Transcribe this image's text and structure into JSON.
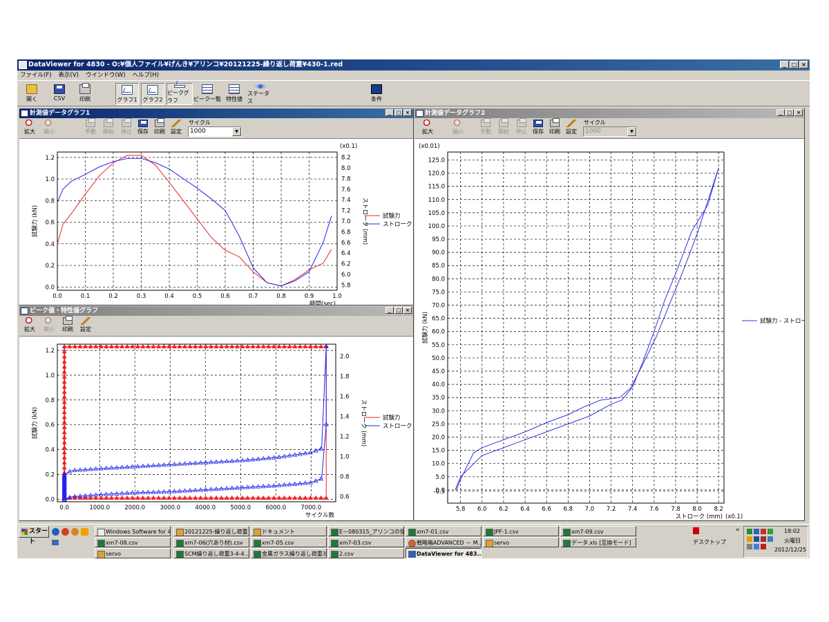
{
  "app": {
    "title": "DataViewer for 4830 - O:¥個人ファイル¥げんき¥アリンコ¥20121225-繰り返し荷重¥430-1.red"
  },
  "menu": [
    "ファイル(F)",
    "表示(V)",
    "ウインドウ(W)",
    "ヘルプ(H)"
  ],
  "toolbar": {
    "open": "開く",
    "csv": "CSV",
    "print": "印刷",
    "graph1": "グラフ1",
    "graph2": "グラフ2",
    "peak_graph": "ピークグラフ",
    "peak_list": "ピーク一覧",
    "characteristic": "特性値",
    "status": "ステータス",
    "condition": "条件"
  },
  "win_buttons": {
    "min": "_",
    "max": "□",
    "close": "×"
  },
  "graph1": {
    "title": "計測値データグラフ1",
    "tools": {
      "zoom_in": "拡大",
      "zoom_out": "縮小",
      "manual": "手動",
      "start": "開始",
      "stop": "停止",
      "save": "保存",
      "print": "印刷",
      "settings": "設定"
    },
    "cycle_label": "サイクル",
    "cycle_value": "1000",
    "combo_arrow": "▼"
  },
  "graph2": {
    "title": "計測値データグラフ2",
    "tools": {
      "zoom_in": "拡大",
      "zoom_out": "縮小",
      "manual": "手動",
      "start": "開始",
      "stop": "停止",
      "save": "保存",
      "print": "印刷",
      "settings": "設定"
    },
    "cycle_label": "サイクル",
    "cycle_value": "1000",
    "combo_arrow": "▼"
  },
  "peak": {
    "title": "ピーク値・特性値グラフ",
    "tools": {
      "zoom_in": "拡大",
      "zoom_out": "縮小",
      "print": "印刷",
      "settings": "設定"
    }
  },
  "chart_data": [
    {
      "id": "g1",
      "type": "line",
      "xlabel": "時間(sec)",
      "ylabel": "試験力 (kN)",
      "y2label": "ストローク (mm)",
      "y2unit": "(x0.1)",
      "xlim": [
        0,
        1.0
      ],
      "ylim": [
        -0.03,
        1.25
      ],
      "y2lim": [
        5.7,
        8.3
      ],
      "xticks": [
        "0.0",
        "0.1",
        "0.2",
        "0.3",
        "0.4",
        "0.5",
        "0.6",
        "0.7",
        "0.8",
        "0.9",
        "1.0"
      ],
      "yticks": [
        "0.0",
        "0.2",
        "0.4",
        "0.6",
        "0.8",
        "1.0",
        "1.2"
      ],
      "y2ticks": [
        "5.8",
        "6.0",
        "6.2",
        "6.4",
        "6.6",
        "6.8",
        "7.0",
        "7.2",
        "7.4",
        "7.6",
        "7.8",
        "8.0",
        "8.2"
      ],
      "legend_position": "right",
      "series": [
        {
          "name": "試験力",
          "color": "#ee2222",
          "axis": "y",
          "x": [
            0,
            0.02,
            0.05,
            0.1,
            0.15,
            0.2,
            0.25,
            0.3,
            0.35,
            0.4,
            0.45,
            0.5,
            0.55,
            0.6,
            0.65,
            0.7,
            0.75,
            0.8,
            0.85,
            0.9,
            0.95,
            0.98
          ],
          "y": [
            0.4,
            0.58,
            0.68,
            0.86,
            1.03,
            1.15,
            1.22,
            1.22,
            1.13,
            0.97,
            0.8,
            0.63,
            0.46,
            0.34,
            0.28,
            0.14,
            0.04,
            0.01,
            0.07,
            0.16,
            0.22,
            0.35
          ]
        },
        {
          "name": "ストローク",
          "color": "#2222ee",
          "axis": "y2",
          "x": [
            0,
            0.02,
            0.05,
            0.1,
            0.15,
            0.2,
            0.25,
            0.3,
            0.35,
            0.4,
            0.45,
            0.5,
            0.55,
            0.6,
            0.65,
            0.7,
            0.75,
            0.8,
            0.85,
            0.9,
            0.95,
            0.98
          ],
          "y": [
            7.35,
            7.6,
            7.75,
            7.88,
            8.02,
            8.12,
            8.18,
            8.18,
            8.1,
            7.98,
            7.8,
            7.62,
            7.42,
            7.2,
            6.72,
            6.12,
            5.84,
            5.78,
            5.88,
            6.05,
            6.6,
            7.1
          ]
        }
      ]
    },
    {
      "id": "g2",
      "type": "line",
      "xlabel": "ストローク (mm)",
      "xunit": "(x0.1)",
      "ylabel": "試験力 (kN)",
      "yunit": "(x0.01)",
      "xlim": [
        5.68,
        8.25
      ],
      "ylim": [
        -5,
        128
      ],
      "xticks": [
        "5.8",
        "6.0",
        "6.2",
        "6.4",
        "6.6",
        "6.8",
        "7.0",
        "7.2",
        "7.4",
        "7.6",
        "7.8",
        "8.0",
        "8.2"
      ],
      "yticks": [
        "-0.5",
        "0.0",
        "5.0",
        "10.0",
        "15.0",
        "20.0",
        "25.0",
        "30.0",
        "35.0",
        "40.0",
        "45.0",
        "50.0",
        "55.0",
        "60.0",
        "65.0",
        "70.0",
        "75.0",
        "80.0",
        "85.0",
        "90.0",
        "95.0",
        "100.0",
        "105.0",
        "110.0",
        "115.0",
        "120.0",
        "125.0"
      ],
      "legend_position": "right",
      "series": [
        {
          "name": "試験力 - ストローク",
          "color": "#3333dd",
          "x": [
            5.76,
            5.8,
            5.86,
            5.92,
            6.0,
            6.2,
            6.4,
            6.6,
            6.8,
            6.95,
            7.1,
            7.28,
            7.38,
            7.5,
            7.62,
            7.75,
            7.88,
            8.0,
            8.2,
            8.1,
            7.95,
            7.82,
            7.7,
            7.6,
            7.5,
            7.4,
            7.3,
            7.2,
            7.0,
            6.8,
            6.6,
            6.4,
            6.2,
            6.0,
            5.9,
            5.8,
            5.75
          ],
          "y": [
            0,
            4,
            9,
            14,
            16,
            19,
            22,
            25.5,
            28.5,
            31.5,
            34,
            35,
            38.5,
            48,
            58,
            71,
            84,
            97,
            122,
            108,
            98,
            84,
            72,
            60,
            49,
            39,
            34,
            32.5,
            28,
            25,
            22,
            19,
            16,
            13,
            9,
            5,
            0
          ]
        }
      ]
    },
    {
      "id": "g3",
      "type": "line",
      "xlabel": "サイクル数",
      "ylabel": "試験力 (kN)",
      "y2label": "ストローク (mm)",
      "xlim": [
        -200,
        7700
      ],
      "ylim": [
        -0.02,
        1.25
      ],
      "y2lim": [
        0.55,
        2.12
      ],
      "xticks": [
        "0.0",
        "1000.0",
        "2000.0",
        "3000.0",
        "4000.0",
        "5000.0",
        "6000.0",
        "7000.0"
      ],
      "yticks": [
        "0.0",
        "0.2",
        "0.4",
        "0.6",
        "0.8",
        "1.0",
        "1.2"
      ],
      "y2ticks": [
        "0.6",
        "0.8",
        "1.0",
        "1.2",
        "1.4",
        "1.6",
        "1.8",
        "2.0"
      ],
      "legend_position": "right",
      "series": [
        {
          "name": "試験力",
          "color": "#ee2222",
          "axis": "y",
          "marker": "triangle-filled",
          "top_x": [
            0,
            7430
          ],
          "top_y": [
            1.23,
            1.23
          ],
          "bottom_x": [
            0,
            7430
          ],
          "bottom_y": [
            0.01,
            0.01
          ]
        },
        {
          "name": "ストローク",
          "color": "#2222ee",
          "axis": "y2",
          "marker": "triangle-open",
          "top_x": [
            0,
            200,
            1000,
            2000,
            3000,
            4000,
            5000,
            6000,
            7000,
            7300,
            7430
          ],
          "top_y": [
            0.82,
            0.86,
            0.88,
            0.9,
            0.92,
            0.94,
            0.96,
            0.99,
            1.04,
            1.08,
            2.1
          ],
          "bottom_x": [
            0,
            200,
            1000,
            2000,
            3000,
            4000,
            5000,
            6000,
            7000,
            7300,
            7430
          ],
          "bottom_y": [
            0.57,
            0.6,
            0.62,
            0.64,
            0.65,
            0.67,
            0.69,
            0.71,
            0.74,
            0.78,
            1.32
          ]
        }
      ]
    }
  ],
  "taskbar": {
    "start": "スタート",
    "tasks": [
      {
        "label": "Windows Software for 4...",
        "kind": ""
      },
      {
        "label": "20121225-繰り返し荷重",
        "kind": "sv"
      },
      {
        "label": "ドキュメント",
        "kind": "sv"
      },
      {
        "label": "E－080315_アリンコの保...",
        "kind": "ex"
      },
      {
        "label": "xm7-01.csv",
        "kind": "ex"
      },
      {
        "label": "JPF-1.csv",
        "kind": "ex"
      },
      {
        "label": "xm7-09.csv",
        "kind": "ex"
      },
      {
        "label": "xm7-08.csv",
        "kind": "ex"
      },
      {
        "label": "xm7-06(穴あり材).csv",
        "kind": "ex"
      },
      {
        "label": "xm7-05.csv",
        "kind": "ex"
      },
      {
        "label": "xm7-03.csv",
        "kind": "ex"
      },
      {
        "label": "戦略箱ADVANCED － M...",
        "kind": "ff"
      },
      {
        "label": "servo",
        "kind": "sv"
      },
      {
        "label": "データ.xls [互換モード]",
        "kind": "ex"
      },
      {
        "label": "servo",
        "kind": "sv"
      },
      {
        "label": "SCM繰り返し荷重3-4-4...",
        "kind": "ex"
      },
      {
        "label": "金属ガラス繰り返し荷重3...",
        "kind": "ex"
      },
      {
        "label": "2.csv",
        "kind": "ex"
      },
      {
        "label": "DataViewer for 483...",
        "kind": "dv"
      }
    ],
    "desktop": "デスクトップ",
    "arrows": "«",
    "clock_time": "18:02",
    "clock_day": "火曜日",
    "clock_date": "2012/12/25"
  }
}
